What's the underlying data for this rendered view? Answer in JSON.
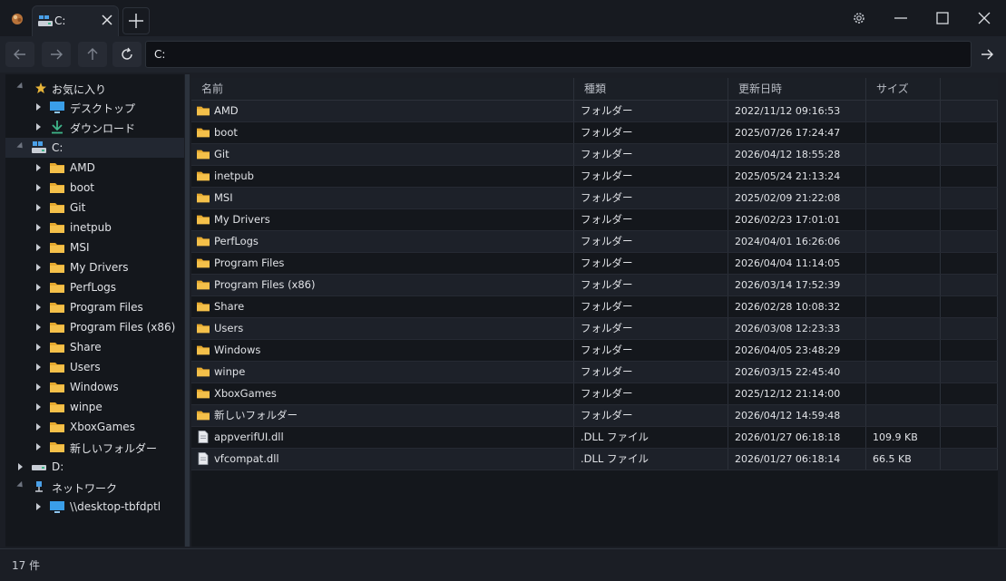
{
  "window": {
    "tab_label": "C:",
    "colors": {
      "folder": "#f4c04a",
      "accent": "#3a8ee6",
      "star": "#e8b53a",
      "download": "#3fb58a"
    }
  },
  "toolbar": {
    "address": "C:",
    "buttons": [
      "back-icon",
      "forward-icon",
      "up-icon",
      "refresh-icon"
    ],
    "go_icon": "arrow-right-icon"
  },
  "sidebar": {
    "favorites": {
      "label": "お気に入り",
      "items": [
        {
          "label": "デスクトップ"
        },
        {
          "label": "ダウンロード"
        }
      ]
    },
    "drive_c": {
      "label": "C:",
      "children": [
        {
          "label": "AMD"
        },
        {
          "label": "boot"
        },
        {
          "label": "Git"
        },
        {
          "label": "inetpub"
        },
        {
          "label": "MSI"
        },
        {
          "label": "My Drivers"
        },
        {
          "label": "PerfLogs"
        },
        {
          "label": "Program Files"
        },
        {
          "label": "Program Files (x86)"
        },
        {
          "label": "Share"
        },
        {
          "label": "Users"
        },
        {
          "label": "Windows"
        },
        {
          "label": "winpe"
        },
        {
          "label": "XboxGames"
        },
        {
          "label": "新しいフォルダー"
        }
      ]
    },
    "drive_d": {
      "label": "D:"
    },
    "network": {
      "label": "ネットワーク",
      "items": [
        {
          "label": "\\\\desktop-tbfdptl"
        }
      ]
    }
  },
  "filelist": {
    "columns": {
      "name": "名前",
      "type": "種類",
      "date": "更新日時",
      "size": "サイズ"
    },
    "rows": [
      {
        "name": "AMD",
        "type": "フォルダー",
        "date": "2022/11/12 09:16:53",
        "size": "",
        "kind": "folder"
      },
      {
        "name": "boot",
        "type": "フォルダー",
        "date": "2025/07/26 17:24:47",
        "size": "",
        "kind": "folder"
      },
      {
        "name": "Git",
        "type": "フォルダー",
        "date": "2026/04/12 18:55:28",
        "size": "",
        "kind": "folder"
      },
      {
        "name": "inetpub",
        "type": "フォルダー",
        "date": "2025/05/24 21:13:24",
        "size": "",
        "kind": "folder"
      },
      {
        "name": "MSI",
        "type": "フォルダー",
        "date": "2025/02/09 21:22:08",
        "size": "",
        "kind": "folder"
      },
      {
        "name": "My Drivers",
        "type": "フォルダー",
        "date": "2026/02/23 17:01:01",
        "size": "",
        "kind": "folder"
      },
      {
        "name": "PerfLogs",
        "type": "フォルダー",
        "date": "2024/04/01 16:26:06",
        "size": "",
        "kind": "folder"
      },
      {
        "name": "Program Files",
        "type": "フォルダー",
        "date": "2026/04/04 11:14:05",
        "size": "",
        "kind": "folder"
      },
      {
        "name": "Program Files (x86)",
        "type": "フォルダー",
        "date": "2026/03/14 17:52:39",
        "size": "",
        "kind": "folder"
      },
      {
        "name": "Share",
        "type": "フォルダー",
        "date": "2026/02/28 10:08:32",
        "size": "",
        "kind": "folder"
      },
      {
        "name": "Users",
        "type": "フォルダー",
        "date": "2026/03/08 12:23:33",
        "size": "",
        "kind": "folder"
      },
      {
        "name": "Windows",
        "type": "フォルダー",
        "date": "2026/04/05 23:48:29",
        "size": "",
        "kind": "folder"
      },
      {
        "name": "winpe",
        "type": "フォルダー",
        "date": "2026/03/15 22:45:40",
        "size": "",
        "kind": "folder"
      },
      {
        "name": "XboxGames",
        "type": "フォルダー",
        "date": "2025/12/12 21:14:00",
        "size": "",
        "kind": "folder"
      },
      {
        "name": "新しいフォルダー",
        "type": "フォルダー",
        "date": "2026/04/12 14:59:48",
        "size": "",
        "kind": "folder"
      },
      {
        "name": "appverifUI.dll",
        "type": ".DLL ファイル",
        "date": "2026/01/27 06:18:18",
        "size": "109.9 KB",
        "kind": "file"
      },
      {
        "name": "vfcompat.dll",
        "type": ".DLL ファイル",
        "date": "2026/01/27 06:18:14",
        "size": "66.5 KB",
        "kind": "file"
      }
    ]
  },
  "status": {
    "count": "17 件"
  }
}
